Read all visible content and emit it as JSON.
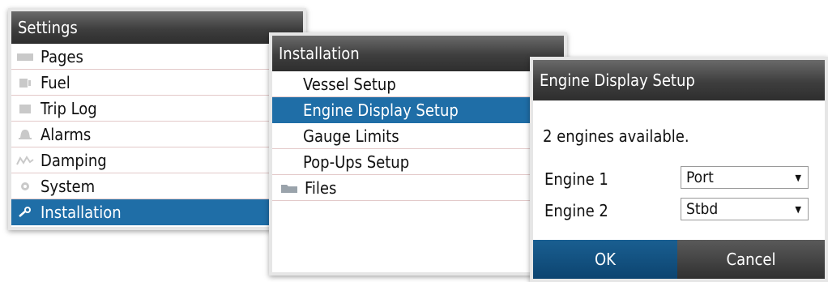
{
  "settings": {
    "title": "Settings",
    "items": [
      {
        "label": "Pages",
        "icon": "pages-icon"
      },
      {
        "label": "Fuel",
        "icon": "fuel-icon"
      },
      {
        "label": "Trip Log",
        "icon": "trip-log-icon"
      },
      {
        "label": "Alarms",
        "icon": "alarm-bell-icon"
      },
      {
        "label": "Damping",
        "icon": "damping-icon"
      },
      {
        "label": "System",
        "icon": "gear-icon"
      },
      {
        "label": "Installation",
        "icon": "wrench-icon",
        "selected": true
      }
    ]
  },
  "installation": {
    "title": "Installation",
    "items": [
      {
        "label": "Vessel Setup"
      },
      {
        "label": "Engine Display Setup",
        "selected": true
      },
      {
        "label": "Gauge Limits"
      },
      {
        "label": "Pop-Ups Setup"
      },
      {
        "label": "Files",
        "icon": "folder-icon"
      }
    ]
  },
  "engine_setup": {
    "title": "Engine Display Setup",
    "available_text": "2 engines available.",
    "engines": [
      {
        "label": "Engine 1",
        "value": "Port"
      },
      {
        "label": "Engine 2",
        "value": "Stbd"
      }
    ],
    "ok_label": "OK",
    "cancel_label": "Cancel"
  },
  "colors": {
    "selected_blue": "#1f6ea7",
    "ok_blue": "#0c4470",
    "titlebar_dark": "#3e3e3e"
  }
}
